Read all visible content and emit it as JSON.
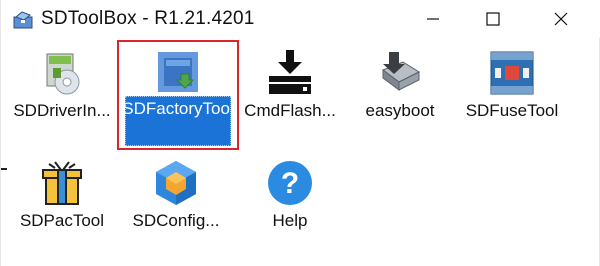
{
  "window": {
    "title": "SDToolBox - R1.21.4201",
    "app_icon": "toolbox-icon",
    "controls": {
      "minimize": "minimize-icon",
      "maximize": "maximize-icon",
      "close": "close-icon"
    }
  },
  "tools": [
    {
      "label": "SDDriverIn...",
      "icon": "driver-installer-icon"
    },
    {
      "label": "SDFactoryTool",
      "icon": "factory-tool-icon",
      "selected": true
    },
    {
      "label": "CmdFlash...",
      "icon": "download-drive-icon"
    },
    {
      "label": "easyboot",
      "icon": "easyboot-icon"
    },
    {
      "label": "SDFuseTool",
      "icon": "fuse-tool-icon"
    },
    {
      "label": "SDPacTool",
      "icon": "pac-tool-icon"
    },
    {
      "label": "SDConfig...",
      "icon": "config-cube-icon"
    },
    {
      "label": "Help",
      "icon": "help-icon"
    }
  ],
  "colors": {
    "selection": "#1b73d8",
    "highlight_frame": "#d8262a",
    "help_blue": "#2a8be0"
  }
}
